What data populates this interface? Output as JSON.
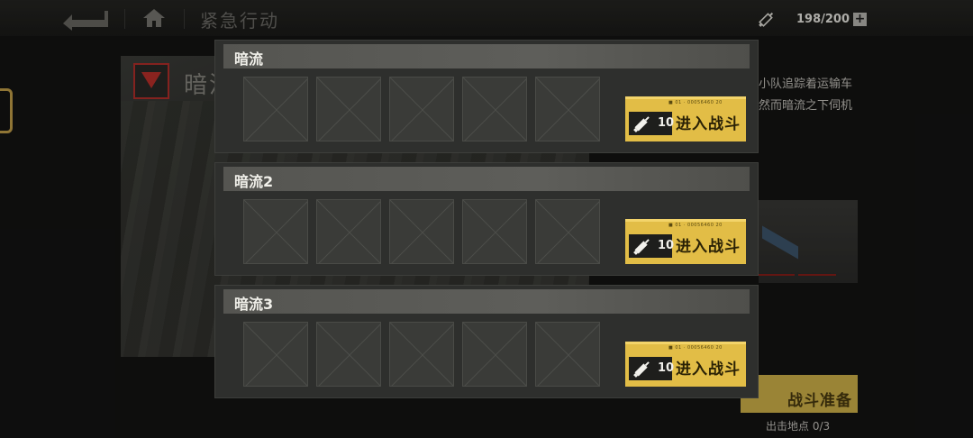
{
  "header": {
    "title": "紧急行动",
    "energy_count": "198/200",
    "energy_plus": "+"
  },
  "background": {
    "mission_name": "暗流",
    "description_line1": "小队追踪着运输车",
    "description_line2": "然而暗流之下伺机",
    "prepare_label": "战斗准备",
    "depart_label": "出击地点 0/3"
  },
  "stages": [
    {
      "title": "暗流",
      "cost": "10",
      "enter_label": "进入战斗",
      "serial": "■ 01 · 00056460 20"
    },
    {
      "title": "暗流2",
      "cost": "10",
      "enter_label": "进入战斗",
      "serial": "■ 01 · 00056460 20"
    },
    {
      "title": "暗流3",
      "cost": "10",
      "enter_label": "进入战斗",
      "serial": "■ 01 · 00056460 20"
    }
  ],
  "colors": {
    "accent_gold": "#e2bd46",
    "panel": "#2e2f2d",
    "header_bar": "#5a5a56",
    "danger_red": "#c0312b"
  },
  "icons": {
    "back": "back-arrow-icon",
    "home": "home-icon",
    "energy": "syringe-icon",
    "cost": "syringe-icon",
    "empty_slot": "cross-placeholder-icon"
  }
}
